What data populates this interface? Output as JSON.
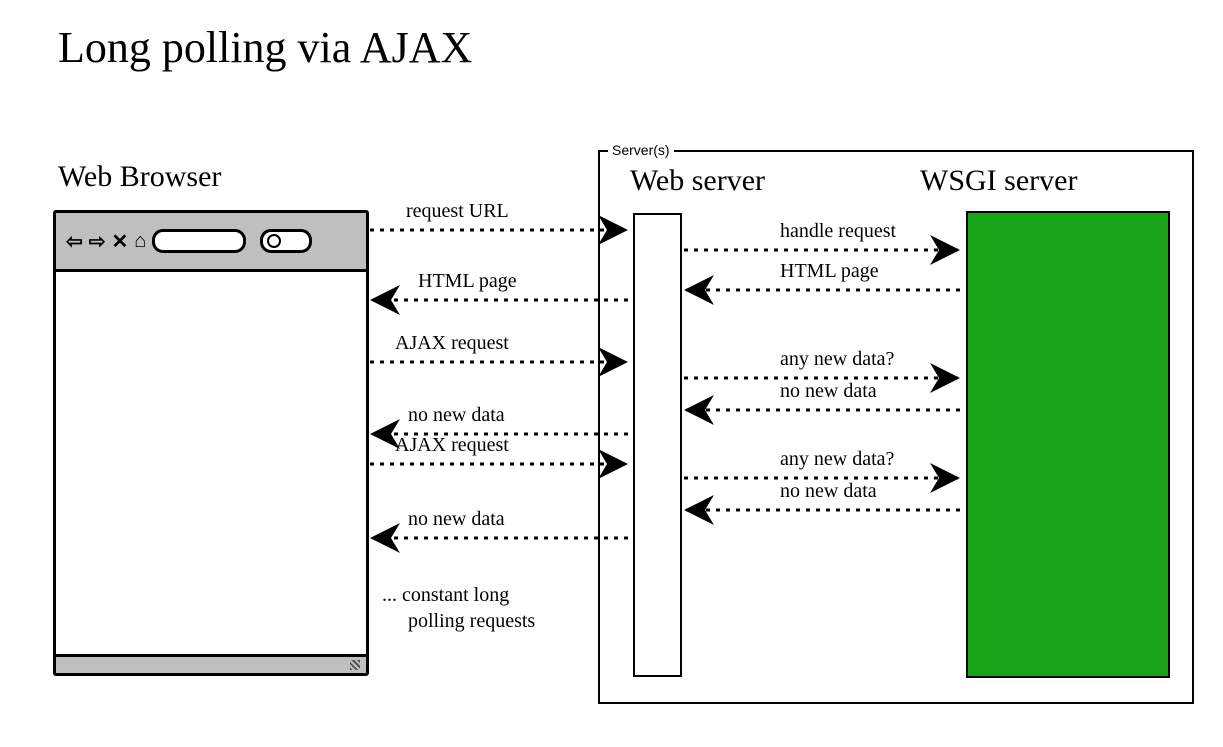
{
  "title": "Long polling via AJAX",
  "browser_label": "Web Browser",
  "servers_legend": "Server(s)",
  "webserver_label": "Web server",
  "wsgi_label": "WSGI server",
  "labels": {
    "requestURL": "request URL",
    "htmlPage_left": "HTML page",
    "ajaxReq1": "AJAX request",
    "noNewData_left1": "no new data",
    "ajaxReq2": "AJAX request",
    "noNewData_left2": "no new data",
    "handleRequest": "handle request",
    "htmlPage_right": "HTML page",
    "anyNewData1": "any new data?",
    "noNewData_right1": "no new data",
    "anyNewData2": "any new data?",
    "noNewData_right2": "no new data"
  },
  "note_line1": "... constant long",
  "note_line2": "polling requests",
  "colors": {
    "wsgi": "#18a418",
    "browser_chrome": "#bfbfbf"
  },
  "chart_data": {
    "type": "sequence-diagram",
    "participants": [
      "Web Browser",
      "Web server",
      "WSGI server"
    ],
    "messages": [
      {
        "from": "Web Browser",
        "to": "Web server",
        "label": "request URL"
      },
      {
        "from": "Web server",
        "to": "WSGI server",
        "label": "handle request"
      },
      {
        "from": "WSGI server",
        "to": "Web server",
        "label": "HTML page"
      },
      {
        "from": "Web server",
        "to": "Web Browser",
        "label": "HTML page"
      },
      {
        "from": "Web Browser",
        "to": "Web server",
        "label": "AJAX request"
      },
      {
        "from": "Web server",
        "to": "WSGI server",
        "label": "any new data?"
      },
      {
        "from": "WSGI server",
        "to": "Web server",
        "label": "no new data"
      },
      {
        "from": "Web server",
        "to": "Web Browser",
        "label": "no new data"
      },
      {
        "from": "Web Browser",
        "to": "Web server",
        "label": "AJAX request"
      },
      {
        "from": "Web server",
        "to": "WSGI server",
        "label": "any new data?"
      },
      {
        "from": "WSGI server",
        "to": "Web server",
        "label": "no new data"
      },
      {
        "from": "Web server",
        "to": "Web Browser",
        "label": "no new data"
      }
    ],
    "note": "... constant long polling requests"
  }
}
